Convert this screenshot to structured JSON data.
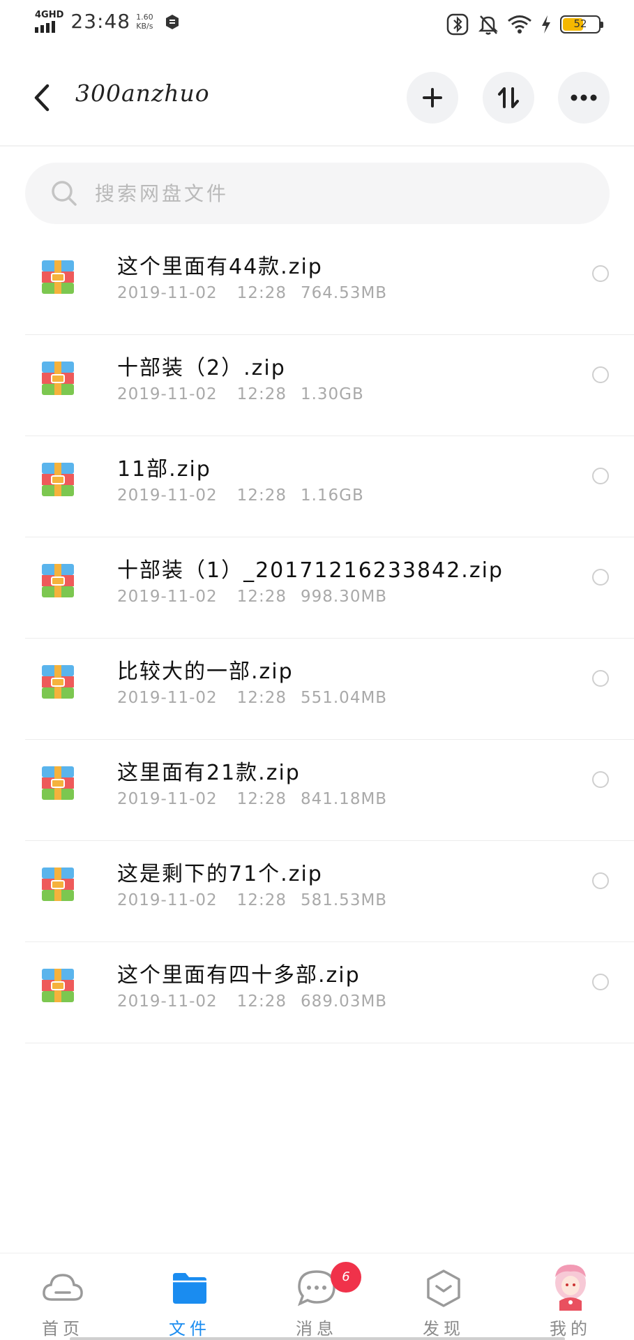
{
  "status_bar": {
    "network": "4GHD",
    "time": "23:48",
    "speed_value": "1.60",
    "speed_unit": "KB/s",
    "battery": "52",
    "icons": [
      "bluetooth-icon",
      "mute-icon",
      "wifi-icon",
      "charging-icon",
      "battery-icon"
    ]
  },
  "header": {
    "title": "300anzhuo",
    "icons": [
      "back-icon",
      "add-icon",
      "sort-icon",
      "more-icon"
    ]
  },
  "search": {
    "placeholder": "搜索网盘文件"
  },
  "files": [
    {
      "name": "这个里面有44款.zip",
      "date": "2019-11-02",
      "time": "12:28",
      "size": "764.53MB"
    },
    {
      "name": "十部装（2）.zip",
      "date": "2019-11-02",
      "time": "12:28",
      "size": "1.30GB"
    },
    {
      "name": "11部.zip",
      "date": "2019-11-02",
      "time": "12:28",
      "size": "1.16GB"
    },
    {
      "name": "十部装（1）_20171216233842.zip",
      "date": "2019-11-02",
      "time": "12:28",
      "size": "998.30MB"
    },
    {
      "name": "比较大的一部.zip",
      "date": "2019-11-02",
      "time": "12:28",
      "size": "551.04MB"
    },
    {
      "name": "这里面有21款.zip",
      "date": "2019-11-02",
      "time": "12:28",
      "size": "841.18MB"
    },
    {
      "name": "这是剩下的71个.zip",
      "date": "2019-11-02",
      "time": "12:28",
      "size": "581.53MB"
    },
    {
      "name": "这个里面有四十多部.zip",
      "date": "2019-11-02",
      "time": "12:28",
      "size": "689.03MB"
    }
  ],
  "nav": {
    "home": "首页",
    "files": "文件",
    "messages": "消息",
    "messages_badge": "6",
    "discover": "发现",
    "mine": "我的",
    "active": "files"
  },
  "colors": {
    "accent": "#1a8cf0",
    "badge": "#f0324a",
    "battery_fill": "#f5b800"
  }
}
